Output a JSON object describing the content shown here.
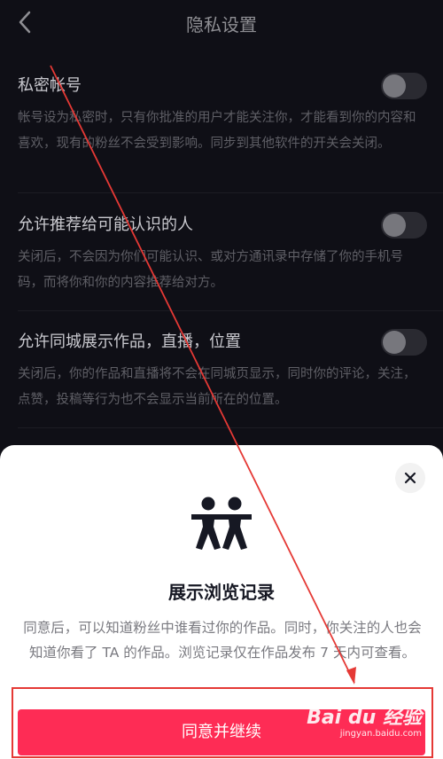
{
  "header": {
    "title": "隐私设置",
    "back_icon": "chevron-left-icon"
  },
  "settings": [
    {
      "label": "私密帐号",
      "description": "帐号设为私密时，只有你批准的用户才能关注你，才能看到你的内容和喜欢，现有的粉丝不会受到影响。同步到其他软件的开关会关闭。",
      "enabled": false
    },
    {
      "label": "允许推荐给可能认识的人",
      "description": "关闭后，不会因为你们可能认识、或对方通讯录中存储了你的手机号码，而将你和你的内容推荐给对方。",
      "enabled": false
    },
    {
      "label": "允许同城展示作品，直播，位置",
      "description": "关闭后，你的作品和直播将不会在同城页显示，同时你的评论，关注，点赞，投稿等行为也不会显示当前所在的位置。",
      "enabled": false
    }
  ],
  "dialog": {
    "icon": "two-people-icon",
    "close_icon": "close-icon",
    "title": "展示浏览记录",
    "description": "同意后，可以知道粉丝中谁看过你的作品。同时，你关注的人也会知道你看了 TA 的作品。浏览记录仅在作品发布 7 天内可查看。",
    "confirm_label": "同意并继续"
  },
  "watermark": {
    "logo": "Bai du 经验",
    "url": "jingyan.baidu.com"
  },
  "colors": {
    "background": "#0f0f16",
    "accent": "#fe2c55",
    "annotation": "#e53935"
  }
}
